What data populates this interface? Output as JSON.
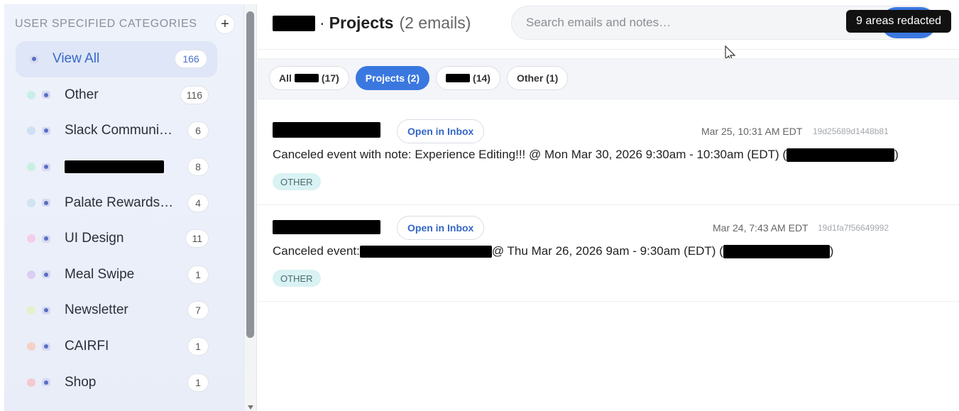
{
  "sidebar": {
    "title": "USER SPECIFIED CATEGORIES",
    "add_label": "+",
    "categories": [
      {
        "name": "View All",
        "count": "166",
        "dot_color": "",
        "active": true
      },
      {
        "name": "Other",
        "count": "116",
        "dot_color": "#c9eee6"
      },
      {
        "name": "Slack Communi…",
        "count": "6",
        "dot_color": "#cfe0f3"
      },
      {
        "name": "",
        "count": "8",
        "dot_color": "#c9efe0",
        "redacted": true
      },
      {
        "name": "Palate Rewards…",
        "count": "4",
        "dot_color": "#cfe4f0"
      },
      {
        "name": "UI Design",
        "count": "11",
        "dot_color": "#f4cde9"
      },
      {
        "name": "Meal Swipe",
        "count": "1",
        "dot_color": "#dccdf3"
      },
      {
        "name": "Newsletter",
        "count": "7",
        "dot_color": "#e4f1c9"
      },
      {
        "name": "CAIRFI",
        "count": "1",
        "dot_color": "#f6d2c6"
      },
      {
        "name": "Shop",
        "count": "1",
        "dot_color": "#f4c9cf"
      }
    ]
  },
  "header": {
    "separator": "·",
    "title": "Projects",
    "email_count": "(2 emails)"
  },
  "search": {
    "placeholder": "Search emails and notes…"
  },
  "redaction_badge": "9 areas redacted",
  "filters": [
    {
      "label_prefix": "All",
      "label_suffix": "(17)",
      "active": false
    },
    {
      "label_prefix": "Projects (2)",
      "label_suffix": "",
      "active": true
    },
    {
      "label_prefix": "",
      "label_suffix": "(14)",
      "active": false
    },
    {
      "label_prefix": "Other (1)",
      "label_suffix": "",
      "active": false
    }
  ],
  "emails": [
    {
      "open_label": "Open in Inbox",
      "date": "Mar 25, 10:31 AM EDT",
      "message_id": "19d25689d1448b81",
      "subject_start": "Canceled event with note: Experience Editing!!! @ Mon Mar 30, 2026 9:30am - 10:30am (EDT) (",
      "subject_end": ")",
      "label": "OTHER"
    },
    {
      "open_label": "Open in Inbox",
      "date": "Mar 24, 7:43 AM EDT",
      "message_id": "19d1fa7f56649992",
      "subject_start": "Canceled event: ",
      "subject_mid": " @ Thu Mar 26, 2026 9am - 9:30am (EDT) (",
      "subject_end": ")",
      "label": "OTHER"
    }
  ],
  "colors": {
    "accent": "#3a78e0",
    "active_text": "#3569c9",
    "label_bg": "#d9f2f3"
  }
}
